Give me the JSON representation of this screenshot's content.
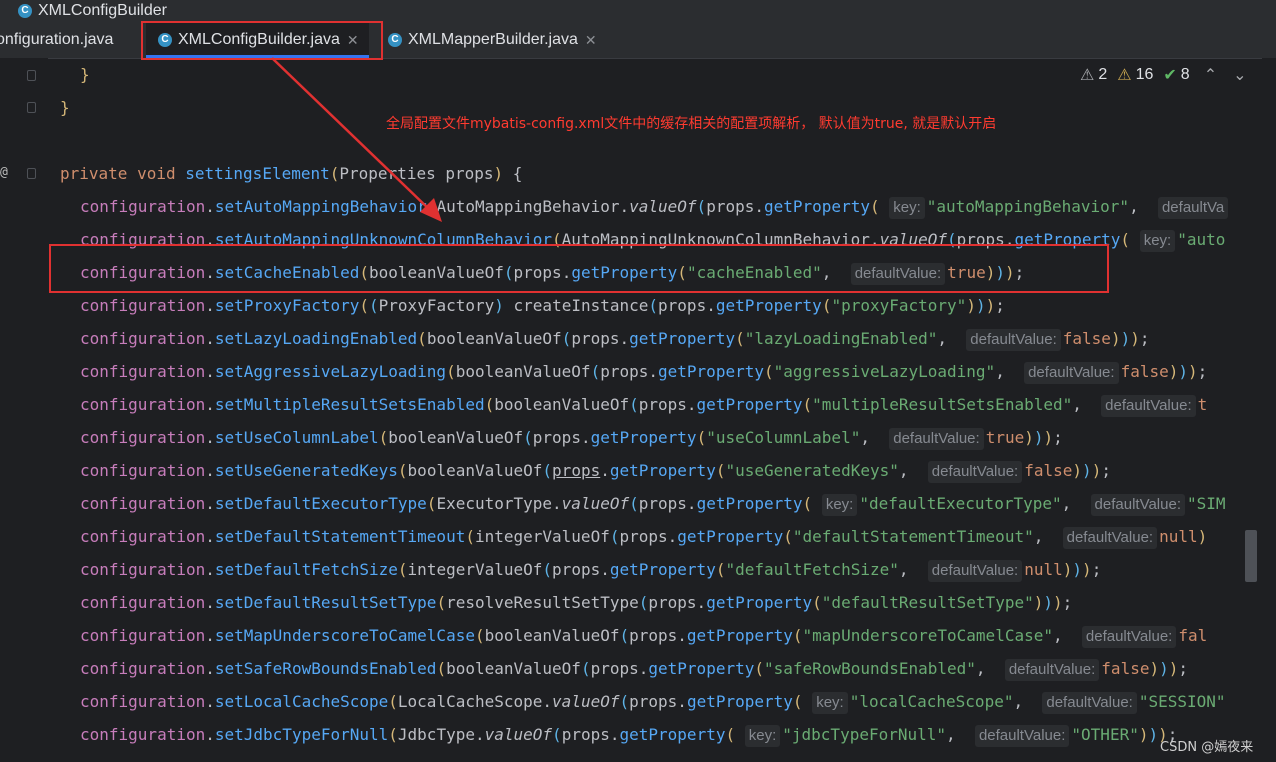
{
  "breadcrumb": {
    "class_icon": "C",
    "label": "XMLConfigBuilder"
  },
  "tabs": [
    {
      "label": "onfiguration.java",
      "icon": "class-icon",
      "active": false,
      "closable": false
    },
    {
      "label": "XMLConfigBuilder.java",
      "icon": "class-icon",
      "active": true,
      "closable": true
    },
    {
      "label": "XMLMapperBuilder.java",
      "icon": "class-icon",
      "active": false,
      "closable": true
    }
  ],
  "inspections": {
    "warning_icon_1": "⚠",
    "warnings_a": "2",
    "warning_icon_2": "⚠",
    "warnings_b": "16",
    "check_icon": "✔",
    "ok_count": "8",
    "up": "⌃",
    "down": "⌄"
  },
  "annotation": "全局配置文件mybatis-config.xml文件中的缓存相关的配置项解析， 默认值为true, 就是默认开启",
  "gutter": {
    "override_marker": "@"
  },
  "code": {
    "brace1": "}",
    "brace2": "}",
    "method_sig": {
      "private": "private",
      "void": "void",
      "name": "settingsElement",
      "type": "Properties",
      "param": "props"
    },
    "calls": {
      "setAutoMappingBehavior": {
        "method": "setAutoMappingBehavior",
        "class": "AutoMappingBehavior",
        "key": "\"autoMappingBehavior\"",
        "hint_default": "defaultVa"
      },
      "setAutoMappingUnknownColumnBehavior": {
        "method": "setAutoMappingUnknownColumnBehavior",
        "class": "AutoMappingUnknownColumnBehavior",
        "key": "\"auto"
      },
      "setCacheEnabled": {
        "method": "setCacheEnabled",
        "key": "\"cacheEnabled\"",
        "default": "true"
      },
      "setProxyFactory": {
        "method": "setProxyFactory",
        "cast": "ProxyFactory",
        "key": "\"proxyFactory\""
      },
      "setLazyLoadingEnabled": {
        "method": "setLazyLoadingEnabled",
        "key": "\"lazyLoadingEnabled\"",
        "default": "false"
      },
      "setAggressiveLazyLoading": {
        "method": "setAggressiveLazyLoading",
        "key": "\"aggressiveLazyLoading\"",
        "default": "false"
      },
      "setMultipleResultSetsEnabled": {
        "method": "setMultipleResultSetsEnabled",
        "key": "\"multipleResultSetsEnabled\"",
        "default": "t"
      },
      "setUseColumnLabel": {
        "method": "setUseColumnLabel",
        "key": "\"useColumnLabel\"",
        "default": "true"
      },
      "setUseGeneratedKeys": {
        "method": "setUseGeneratedKeys",
        "key": "\"useGeneratedKeys\"",
        "default": "false"
      },
      "setDefaultExecutorType": {
        "method": "setDefaultExecutorType",
        "class": "ExecutorType",
        "key": "\"defaultExecutorType\"",
        "default": "\"SIM"
      },
      "setDefaultStatementTimeout": {
        "method": "setDefaultStatementTimeout",
        "key": "\"defaultStatementTimeout\"",
        "default": "null"
      },
      "setDefaultFetchSize": {
        "method": "setDefaultFetchSize",
        "key": "\"defaultFetchSize\"",
        "default": "null"
      },
      "setDefaultResultSetType": {
        "method": "setDefaultResultSetType",
        "key": "\"defaultResultSetType\""
      },
      "setMapUnderscoreToCamelCase": {
        "method": "setMapUnderscoreToCamelCase",
        "key": "\"mapUnderscoreToCamelCase\"",
        "default": "fal"
      },
      "setSafeRowBoundsEnabled": {
        "method": "setSafeRowBoundsEnabled",
        "key": "\"safeRowBoundsEnabled\"",
        "default": "false"
      },
      "setLocalCacheScope": {
        "method": "setLocalCacheScope",
        "class": "LocalCacheScope",
        "key": "\"localCacheScope\"",
        "default": "\"SESSION\""
      },
      "setJdbcTypeForNull": {
        "method": "setJdbcTypeForNull",
        "class": "JdbcType",
        "key": "\"jdbcTypeForNull\"",
        "default": "\"OTHER\""
      }
    },
    "tokens": {
      "configuration": "configuration",
      "props": "props",
      "getProperty": "getProperty",
      "valueOf": "valueOf",
      "booleanValueOf": "booleanValueOf",
      "integerValueOf": "integerValueOf",
      "createInstance": "createInstance",
      "resolveResultSetType": "resolveResultSetType",
      "key_hint": "key:",
      "default_hint": "defaultValue:"
    }
  },
  "watermark": "CSDN @嫣夜来",
  "colors": {
    "annotation": "#ff3b30",
    "highlight_box": "#e03131",
    "background": "#1e1f22",
    "tab_underline": "#3574f0"
  }
}
